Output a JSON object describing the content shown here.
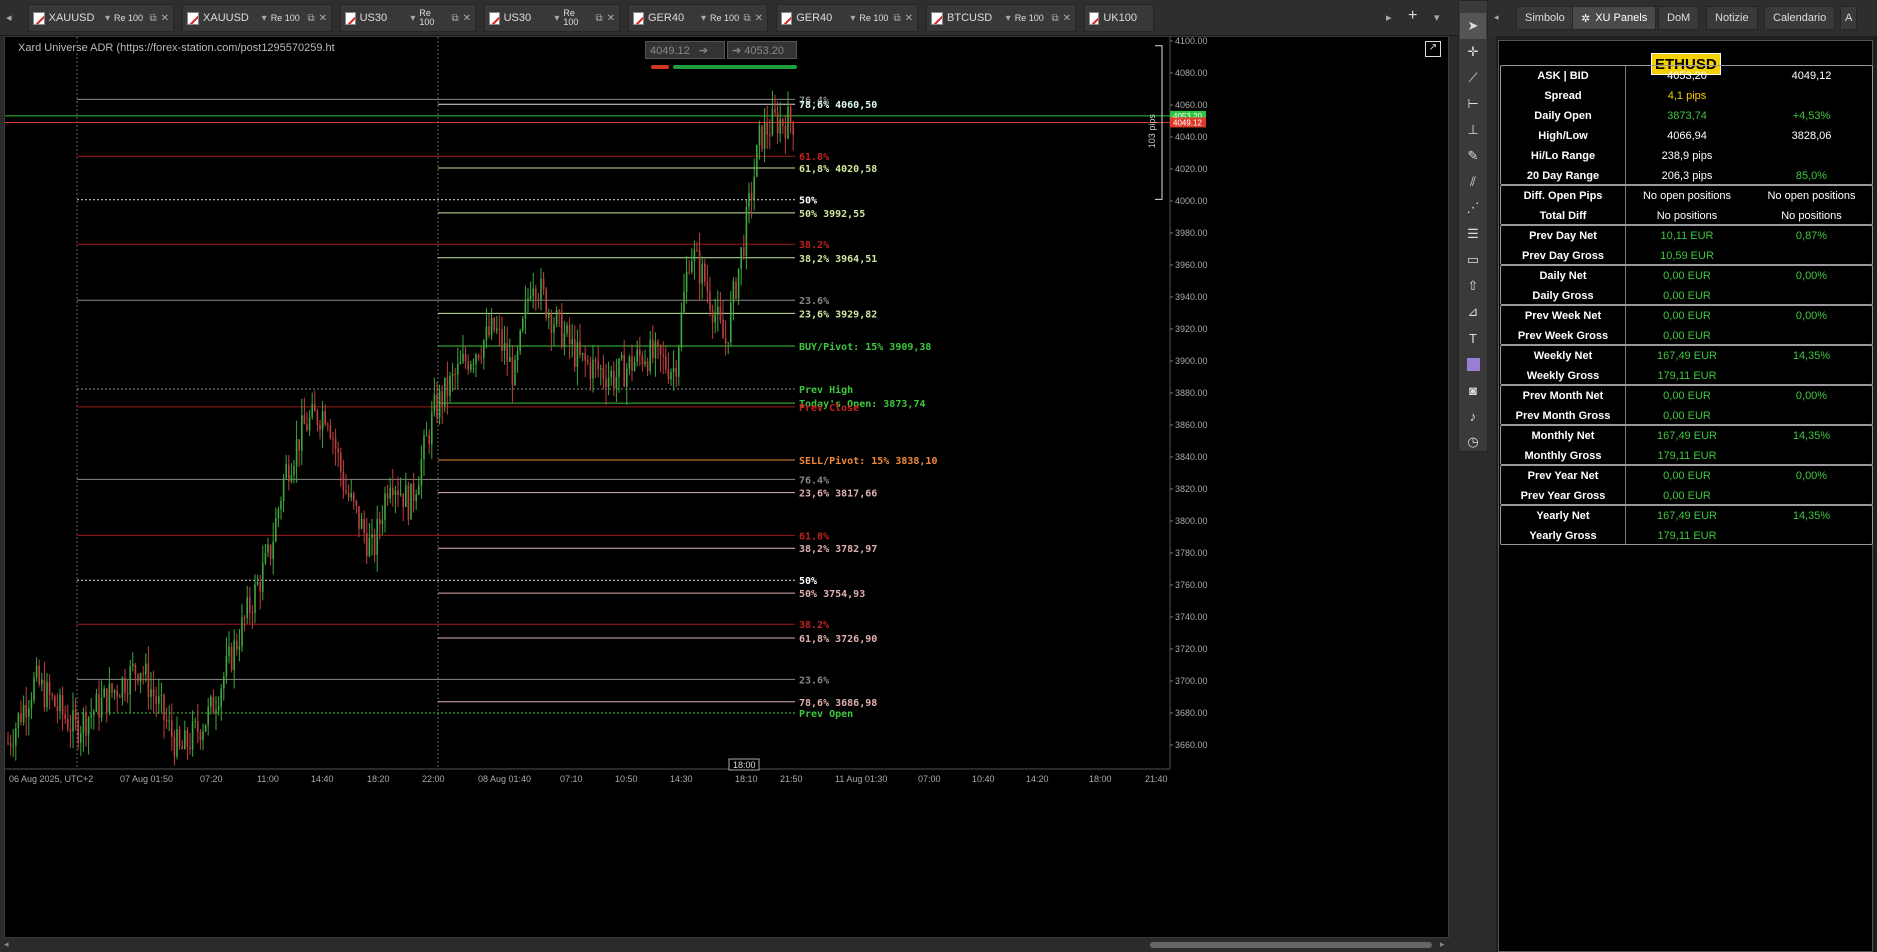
{
  "tabs": [
    {
      "name": "XAUUSD",
      "res": "Re 100"
    },
    {
      "name": "XAUUSD",
      "res": "Re 100"
    },
    {
      "name": "US30",
      "res": "Re 100"
    },
    {
      "name": "US30",
      "res": "Re 100"
    },
    {
      "name": "GER40",
      "res": "Re 100"
    },
    {
      "name": "GER40",
      "res": "Re 100"
    },
    {
      "name": "BTCUSD",
      "res": "Re 100"
    },
    {
      "name": "UK100",
      "res": ""
    }
  ],
  "tabbar_icons": {
    "left": "◂",
    "right": "▸",
    "add": "+",
    "menu": "▾"
  },
  "right_tabs": {
    "simbolo": "Simbolo",
    "xu": "XU Panels",
    "dom": "DoM",
    "notizie": "Notizie",
    "calendario": "Calendario",
    "more": "A"
  },
  "chart": {
    "indicator_label": "Xard Universe ADR (https://forex-station.com/post1295570259.ht",
    "ask_box": "4049.12",
    "bid_box": "4053.20",
    "range_label": "103 pips",
    "price_ticks": [
      "4100.00",
      "4080.00",
      "4060.00",
      "4040.00",
      "4020.00",
      "4000.00",
      "3980.00",
      "3960.00",
      "3940.00",
      "3920.00",
      "3900.00",
      "3880.00",
      "3860.00",
      "3840.00",
      "3820.00",
      "3800.00",
      "3780.00",
      "3760.00",
      "3740.00",
      "3720.00",
      "3700.00",
      "3680.00",
      "3660.00"
    ],
    "ask_tag": "4053.20",
    "bid_tag": "4049.12",
    "time_ticks": [
      "06 Aug 2025, UTC+2",
      "07 Aug 01:50",
      "07:20",
      "11:00",
      "14:40",
      "18:20",
      "22:00",
      "08 Aug 01:40",
      "07:10",
      "10:50",
      "14:30",
      "18:10",
      "21:50",
      "11 Aug 01:30",
      "07:00",
      "10:40",
      "14:20",
      "18:00",
      "21:40"
    ],
    "time_cursor": "18:00",
    "levels": {
      "l1": "76.4%",
      "l2": "78,6% 4060,50",
      "l3": "61.8%",
      "l4": "61,8% 4020,58",
      "l5": "50%",
      "l6": "50% 3992,55",
      "l7": "38.2%",
      "l8": "38,2% 3964,51",
      "l9": "23.6%",
      "l10": "23,6% 3929,82",
      "l11": "BUY/Pivot: 15% 3909,38",
      "l12": "Prev High",
      "l13": "Today's Open: 3873,74",
      "l14": "Prev Close",
      "l15": "SELL/Pivot: 15% 3838,10",
      "l16": "76.4%",
      "l17": "23,6% 3817,66",
      "l18": "61.8%",
      "l19": "38,2% 3782,97",
      "l20": "50%",
      "l21": "50% 3754,93",
      "l22": "38.2%",
      "l23": "61,8% 3726,90",
      "l24": "23.6%",
      "l25": "78,6% 3686,98",
      "l26": "Prev Open"
    }
  },
  "panel": {
    "symbol": "ETHUSD",
    "rows": [
      {
        "a": "ASK | BID",
        "b": "4053,20",
        "c": "4049,12"
      },
      {
        "a": "Spread",
        "b": "4,1 pips",
        "c": ""
      },
      {
        "a": "Daily Open",
        "b": "3873,74",
        "c": "+4,53%"
      },
      {
        "a": "High/Low",
        "b": "4066,94",
        "c": "3828,06"
      },
      {
        "a": "Hi/Lo Range",
        "b": "238,9 pips",
        "c": ""
      },
      {
        "a": "20 Day Range",
        "b": "206,3 pips",
        "c": "85,0%"
      },
      {
        "a": "Diff. Open Pips",
        "b": "No open positions",
        "c": "No open positions"
      },
      {
        "a": "Total Diff",
        "b": "No positions",
        "c": "No positions"
      },
      {
        "a": "Prev Day Net",
        "b": "10,11 EUR",
        "c": "0,87%"
      },
      {
        "a": "Prev Day Gross",
        "b": "10,59 EUR",
        "c": ""
      },
      {
        "a": "Daily Net",
        "b": "0,00 EUR",
        "c": "0,00%"
      },
      {
        "a": "Daily Gross",
        "b": "0,00 EUR",
        "c": ""
      },
      {
        "a": "Prev Week Net",
        "b": "0,00 EUR",
        "c": "0,00%"
      },
      {
        "a": "Prev Week Gross",
        "b": "0,00 EUR",
        "c": ""
      },
      {
        "a": "Weekly Net",
        "b": "167,49 EUR",
        "c": "14,35%"
      },
      {
        "a": "Weekly Gross",
        "b": "179,11 EUR",
        "c": ""
      },
      {
        "a": "Prev Month Net",
        "b": "0,00 EUR",
        "c": "0,00%"
      },
      {
        "a": "Prev Month Gross",
        "b": "0,00 EUR",
        "c": ""
      },
      {
        "a": "Monthly Net",
        "b": "167,49 EUR",
        "c": "14,35%"
      },
      {
        "a": "Monthly Gross",
        "b": "179,11 EUR",
        "c": ""
      },
      {
        "a": "Prev Year Net",
        "b": "0,00 EUR",
        "c": "0,00%"
      },
      {
        "a": "Prev Year Gross",
        "b": "0,00 EUR",
        "c": ""
      },
      {
        "a": "Yearly Net",
        "b": "167,49 EUR",
        "c": "14,35%"
      },
      {
        "a": "Yearly Gross",
        "b": "179,11 EUR",
        "c": ""
      }
    ]
  }
}
